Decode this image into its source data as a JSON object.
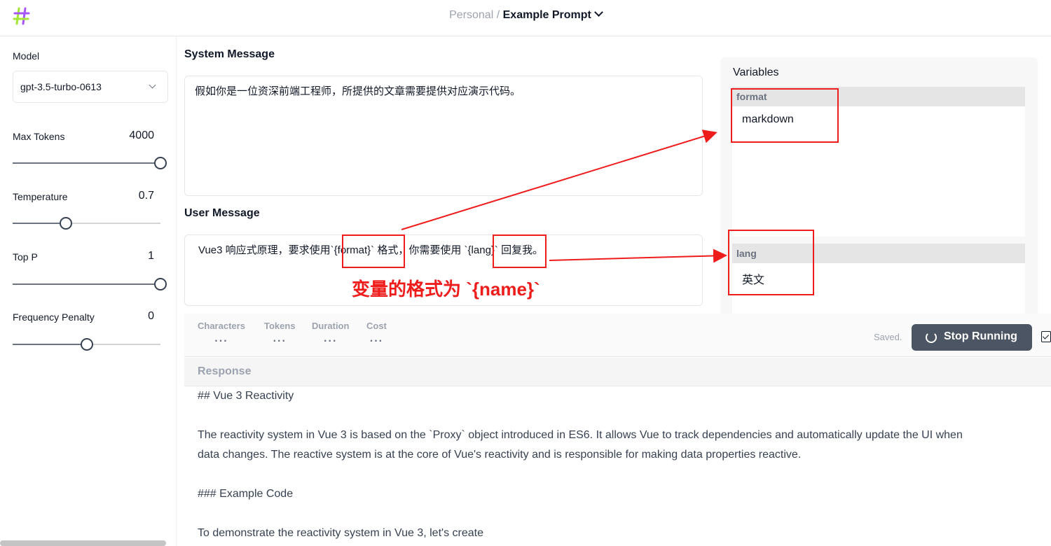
{
  "header": {
    "workspace": "Personal",
    "separator": "/",
    "prompt_name": "Example Prompt",
    "logo_colors": [
      "#a3e635",
      "#a855f7"
    ]
  },
  "sidebar": {
    "model": {
      "label": "Model",
      "value": "gpt-3.5-turbo-0613"
    },
    "max_tokens": {
      "label": "Max Tokens",
      "value": "4000",
      "fraction": 1.0
    },
    "temperature": {
      "label": "Temperature",
      "value": "0.7",
      "fraction": 0.36
    },
    "top_p": {
      "label": "Top P",
      "value": "1",
      "fraction": 1.0
    },
    "frequency_penalty": {
      "label": "Frequency Penalty",
      "value": "0",
      "fraction": 0.5
    }
  },
  "system_message": {
    "title": "System Message",
    "text": "假如你是一位资深前端工程师，所提供的文章需要提供对应演示代码。"
  },
  "user_message": {
    "title": "User Message",
    "parts": [
      "Vue3 响应式原理，要求使用",
      "`{format}`",
      "格式，你需要使用",
      "`{lang}`",
      "回复我。"
    ]
  },
  "variables": {
    "title": "Variables",
    "items": [
      {
        "name": "format",
        "value": "markdown"
      },
      {
        "name": "lang",
        "value": "英文"
      }
    ]
  },
  "annotation": {
    "text": "变量的格式为 `{name}`",
    "color": "#ef1c1c"
  },
  "stats": {
    "items": [
      {
        "label": "Characters",
        "value": "..."
      },
      {
        "label": "Tokens",
        "value": "..."
      },
      {
        "label": "Duration",
        "value": "..."
      },
      {
        "label": "Cost",
        "value": "..."
      }
    ],
    "saved": "Saved.",
    "stop_button": "Stop Running"
  },
  "response": {
    "title": "Response",
    "lines": [
      "## Vue 3 Reactivity",
      "",
      "The reactivity system in Vue 3 is based on the `Proxy` object introduced in ES6. It allows Vue to track dependencies and automatically update the UI when",
      "data changes. The reactive system is at the core of Vue's reactivity and is responsible for making data properties reactive.",
      "",
      "### Example Code",
      "",
      "To demonstrate the reactivity system in Vue 3, let's create"
    ]
  }
}
